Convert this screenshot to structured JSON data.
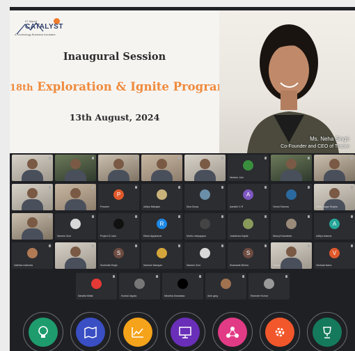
{
  "slide": {
    "logo_top": "IIT Mandi",
    "logo_name": "CATALYST",
    "logo_tagline": "A Technology Business Incubator",
    "title": "Inaugural Session",
    "program_prefix": "18th",
    "program_rest": " Exploration & Ignite Program",
    "date": "13th August, 2024"
  },
  "speaker": {
    "name": "Ms. Neha Singh",
    "role": "Co-Founder and CEO of Tracxn"
  },
  "participants": [
    {
      "name": "",
      "kind": "video",
      "variant": "v2"
    },
    {
      "name": "",
      "kind": "video",
      "variant": "v3"
    },
    {
      "name": "",
      "kind": "video",
      "variant": "v4"
    },
    {
      "name": "",
      "kind": "video",
      "variant": ""
    },
    {
      "name": "",
      "kind": "video",
      "variant": "v2"
    },
    {
      "name": "Neelam Jotn",
      "kind": "avatar",
      "letter": "",
      "color": "#3a8f3f"
    },
    {
      "name": "",
      "kind": "video",
      "variant": "v3"
    },
    {
      "name": "",
      "kind": "video",
      "variant": "v4"
    },
    {
      "name": "",
      "kind": "video",
      "variant": "v2"
    },
    {
      "name": "",
      "kind": "video",
      "variant": ""
    },
    {
      "name": "Praveen",
      "kind": "avatar",
      "letter": "P",
      "color": "#e0592a"
    },
    {
      "name": "Aditya Mahajan",
      "kind": "avatar",
      "letter": "",
      "color": "#c9b27a"
    },
    {
      "name": "Diva Surya",
      "kind": "avatar",
      "letter": "",
      "color": "#6b8fa8"
    },
    {
      "name": "Aarabhi G R",
      "kind": "avatar",
      "letter": "A",
      "color": "#7e57c2"
    },
    {
      "name": "Vishal Sharma",
      "kind": "avatar",
      "letter": "",
      "color": "#2b6aa0"
    },
    {
      "name": "Vikas Sagar Singha",
      "kind": "video",
      "variant": "v2"
    },
    {
      "name": "",
      "kind": "video",
      "variant": "v4"
    },
    {
      "name": "Naveen Soni",
      "kind": "avatar",
      "letter": "",
      "color": "#d8d8d8"
    },
    {
      "name": "Project D Labs",
      "kind": "avatar",
      "letter": "",
      "color": "#111111"
    },
    {
      "name": "Rahul Ajaykumar",
      "kind": "avatar",
      "letter": "R",
      "color": "#1e88e5"
    },
    {
      "name": "Muthu meiyappan",
      "kind": "avatar",
      "letter": "",
      "color": "#444444"
    },
    {
      "name": "Judeshwa Kapila",
      "kind": "avatar",
      "letter": "",
      "color": "#8a9a5b"
    },
    {
      "name": "Manoj Khandekar",
      "kind": "avatar",
      "letter": "",
      "color": "#9a8a7a"
    },
    {
      "name": "Aditya sharma",
      "kind": "avatar",
      "letter": "A",
      "color": "#26a69a"
    },
    {
      "name": "Vaibhav malhotra",
      "kind": "avatar",
      "letter": "",
      "color": "#b07a55"
    },
    {
      "name": "",
      "kind": "video",
      "variant": "v2"
    },
    {
      "name": "Sushmita Singh",
      "kind": "avatar",
      "letter": "S",
      "color": "#6d4c41"
    },
    {
      "name": "Santosh Narayan",
      "kind": "avatar",
      "letter": "",
      "color": "#d4a63a"
    },
    {
      "name": "Naveen Soni",
      "kind": "avatar",
      "letter": "",
      "color": "#d8d8d8"
    },
    {
      "name": "Shashwat Mishra",
      "kind": "avatar",
      "letter": "S",
      "color": "#6d4c41"
    },
    {
      "name": "Tracxn",
      "kind": "video",
      "variant": "v2"
    },
    {
      "name": "Venkata Narra",
      "kind": "avatar",
      "letter": "V",
      "color": "#e0592a"
    },
    {
      "name": "Nandita Mittal",
      "kind": "avatar",
      "letter": "",
      "color": "#e53935"
    },
    {
      "name": "Kushal Jagota",
      "kind": "avatar",
      "letter": "",
      "color": "#777777"
    },
    {
      "name": "Niharika Dwarakas",
      "kind": "avatar",
      "letter": "",
      "color": "#000000"
    },
    {
      "name": "Alok garg",
      "kind": "avatar",
      "letter": "",
      "color": "#a0724f"
    },
    {
      "name": "Ravinder Kumar",
      "kind": "avatar",
      "letter": "",
      "color": "#999999"
    }
  ],
  "bottom_icons": [
    {
      "icon": "bulb-icon",
      "color": "#1e9c6e"
    },
    {
      "icon": "map-icon",
      "color": "#3a4fc4"
    },
    {
      "icon": "growth-chart-icon",
      "color": "#f5a31a"
    },
    {
      "icon": "presentation-icon",
      "color": "#6a2fb8"
    },
    {
      "icon": "network-icon",
      "color": "#e23b86"
    },
    {
      "icon": "gear-icon",
      "color": "#f2572b"
    },
    {
      "icon": "trophy-icon",
      "color": "#157a5b"
    }
  ]
}
